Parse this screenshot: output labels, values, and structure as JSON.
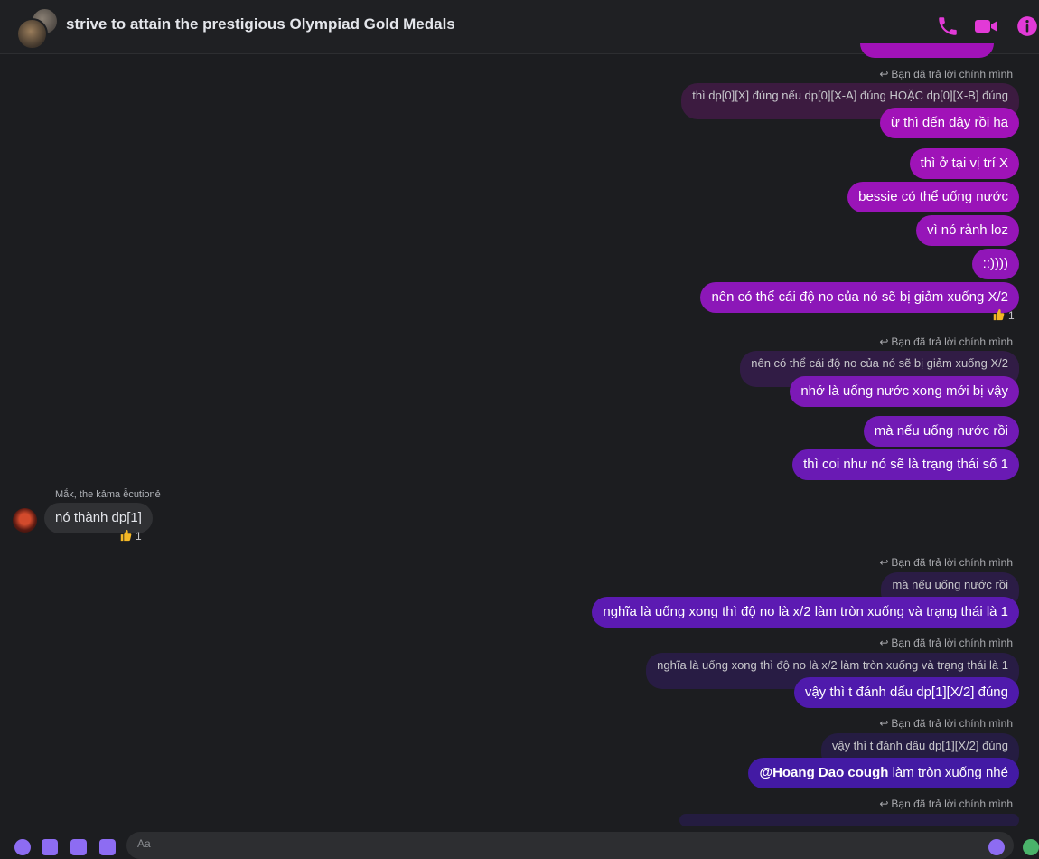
{
  "header": {
    "title": "strive to attain the prestigious Olympiad Gold Medals",
    "accent": "#e23ad7"
  },
  "reply_label": "Bạn đã trả lời chính mình",
  "messages": {
    "q1": "thì dp[0][X] đúng nếu dp[0][X-A] đúng HOẶC dp[0][X-B] đúng",
    "m1": "ừ thì đến đây rồi ha",
    "m2": "thì ở tại vị trí X",
    "m3": "bessie có thể uống nước",
    "m4": "vì nó rảnh loz",
    "m5": "::))))",
    "m6": "nên có thể cái độ no của nó sẽ bị giảm xuống X/2",
    "m6_react_count": "1",
    "q2": "nên có thể cái độ no của nó sẽ bị giảm xuống X/2",
    "m7": "nhớ là uống nước xong mới bị vậy",
    "m8": "mà nếu uống nước rồi",
    "m9": "thì coi như nó sẽ là trạng thái số 1",
    "in_name": "Mắk, the kảma ễcutionẻ",
    "in_msg": "nó thành dp[1]",
    "in_react_count": "1",
    "q3": "mà nếu uống nước rồi",
    "m10": "nghĩa là uống xong thì độ no là x/2 làm tròn xuống và trạng thái là 1",
    "q4": "nghĩa là uống xong thì độ no là x/2 làm tròn xuống và trạng thái là 1",
    "m11": "vậy thì t đánh dấu dp[1][X/2] đúng",
    "q5": "vậy thì t đánh dấu dp[1][X/2] đúng",
    "m12_mention": "@Hoang Dao cough",
    "m12_text": " làm tròn xuống nhé"
  },
  "composer": {
    "placeholder": "Aa"
  },
  "colors": {
    "bubble_magenta": "#a112b8",
    "bubble_violet": "#8218b8",
    "bubble_purple": "#5a1ab0",
    "bubble_indigo": "#3d1a9a",
    "quote_bg": "#33213d"
  }
}
